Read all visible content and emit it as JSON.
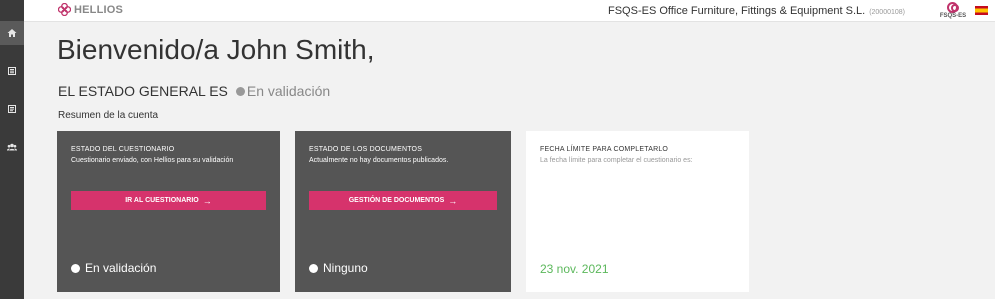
{
  "header": {
    "logo_text": "HELLIOS",
    "company_name": "FSQS-ES Office Furniture, Fittings & Equipment S.L.",
    "company_code": "(20000108)",
    "client_logo_text": "FSQS-ES"
  },
  "sidebar": {
    "items": [
      {
        "icon": "home-icon"
      },
      {
        "icon": "list-icon"
      },
      {
        "icon": "document-icon"
      },
      {
        "icon": "users-icon"
      }
    ]
  },
  "main": {
    "welcome": "Bienvenido/a John Smith,",
    "general_status_label": "EL ESTADO GENERAL ES",
    "general_status_value": "En validación",
    "summary_label": "Resumen de la cuenta"
  },
  "cards": {
    "questionnaire": {
      "title": "ESTADO DEL CUESTIONARIO",
      "description": "Cuestionario enviado, con Hellios para su validación",
      "button": "IR AL CUESTIONARIO",
      "status": "En validación"
    },
    "documents": {
      "title": "ESTADO DE LOS DOCUMENTOS",
      "description": "Actualmente no hay documentos publicados.",
      "button": "GESTIÓN DE DOCUMENTOS",
      "status": "Ninguno"
    },
    "deadline": {
      "title": "FECHA LÍMITE PARA COMPLETARLO",
      "description": "La fecha límite para completar el cuestionario es:",
      "date": "23 nov. 2021"
    }
  },
  "colors": {
    "accent": "#d6336c",
    "card_dark": "#555555",
    "deadline_green": "#5cb85c",
    "sidebar": "#3a3a3a"
  }
}
